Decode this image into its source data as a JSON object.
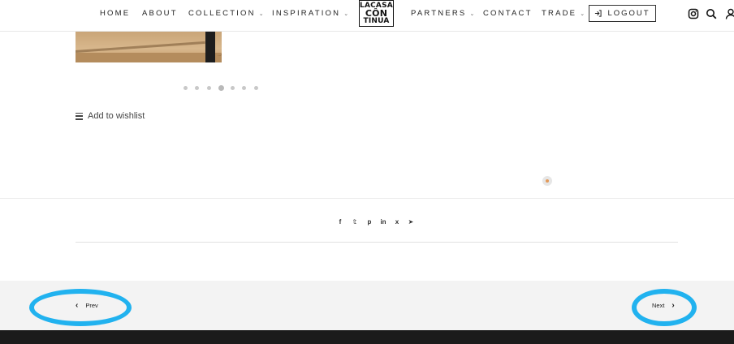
{
  "header": {
    "nav_left": [
      "HOME",
      "ABOUT",
      "COLLECTION",
      "INSPIRATION"
    ],
    "nav_right": [
      "PARTNERS",
      "CONTACT",
      "TRADE"
    ],
    "logo_lines": [
      "LACASA",
      "CÔN",
      "TINUA"
    ],
    "logout_label": "LOGOUT",
    "dropdown_caret": "⌄"
  },
  "carousel": {
    "dot_count": 7,
    "active_index": 3
  },
  "wishlist": {
    "label": "Add to wishlist"
  },
  "share": {
    "icons": [
      "f",
      "𝕥",
      "p",
      "in",
      "x",
      "➤"
    ]
  },
  "pager": {
    "prev_label": "Prev",
    "next_label": "Next",
    "prev_glyph": "‹",
    "next_glyph": "›"
  },
  "colors": {
    "highlight": "#21b2ef",
    "accent_dot": "#e39a5a",
    "footer": "#1b1b1b",
    "pager_bg": "#f3f3f3"
  }
}
